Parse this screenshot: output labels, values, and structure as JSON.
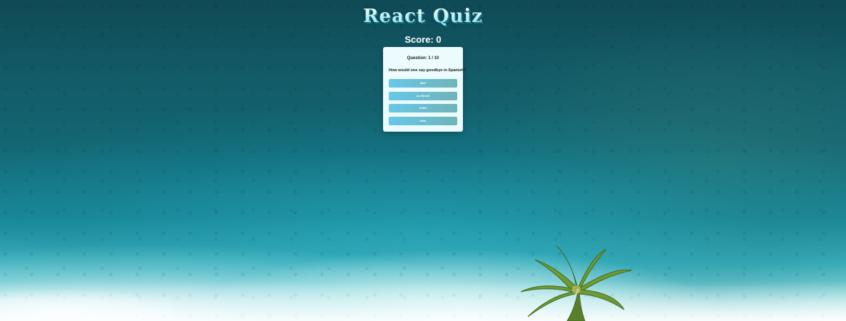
{
  "app": {
    "title": "React Quiz"
  },
  "score": {
    "label": "Score: 0"
  },
  "quiz": {
    "question_counter": "Question: 1 / 10",
    "question_text": "How would one say goodbye in Spanish?",
    "answers": [
      {
        "label": "Salir"
      },
      {
        "label": "Au Revoir"
      },
      {
        "label": "Adiós"
      },
      {
        "label": "Hola"
      }
    ]
  },
  "colors": {
    "title_fill": "#bff4fb",
    "card_background": "#ecfbfd",
    "answer_gradient_start": "#67c8e8",
    "answer_gradient_end": "#6fb3b8"
  }
}
